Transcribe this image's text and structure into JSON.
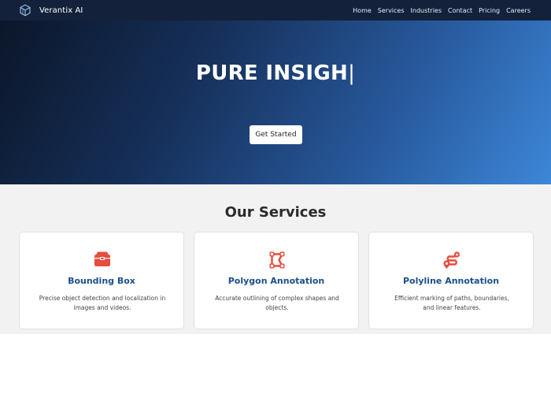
{
  "brand": {
    "name": "Verantix AI",
    "logo_icon": "cube-logo-icon"
  },
  "nav": {
    "links": [
      {
        "label": "Home"
      },
      {
        "label": "Services"
      },
      {
        "label": "Industries"
      },
      {
        "label": "Contact"
      },
      {
        "label": "Pricing"
      },
      {
        "label": "Careers"
      }
    ]
  },
  "hero": {
    "title": "PURE INSIGH",
    "caret": "|",
    "cta_label": "Get Started"
  },
  "services": {
    "title": "Our Services",
    "accent_color": "#e74c3c",
    "title_color": "#1c4f8c",
    "cards": [
      {
        "icon": "box-icon",
        "title": "Bounding Box",
        "description": "Precise object detection and localization in images and videos."
      },
      {
        "icon": "polygon-icon",
        "title": "Polygon Annotation",
        "description": "Accurate outlining of complex shapes and objects."
      },
      {
        "icon": "route-icon",
        "title": "Polyline Annotation",
        "description": "Efficient marking of paths, boundaries, and linear features."
      }
    ]
  }
}
